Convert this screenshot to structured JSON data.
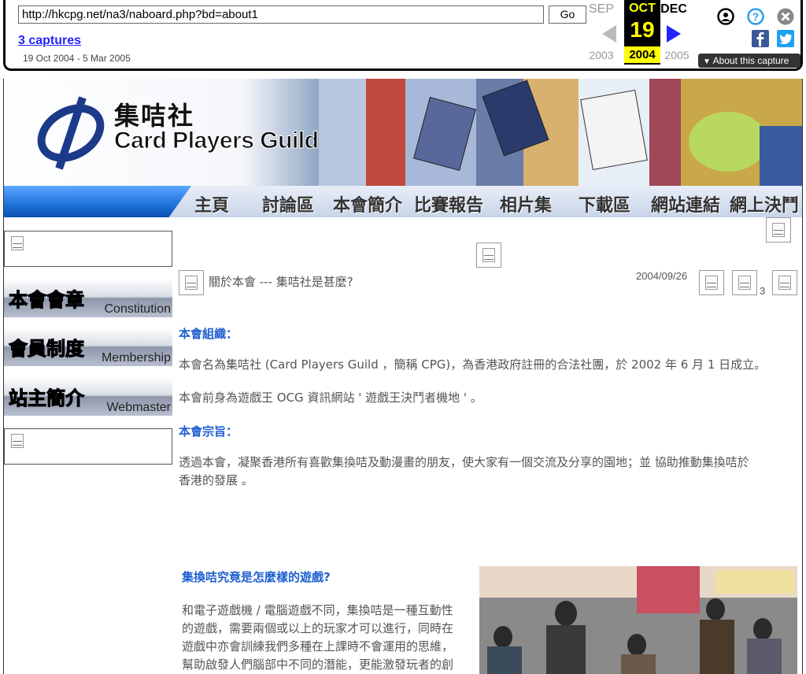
{
  "wayback": {
    "url": "http://hkcpg.net/na3/naboard.php?bd=about1",
    "go_label": "Go",
    "captures_label": "3 captures",
    "date_range": "19 Oct 2004 - 5 Mar 2005",
    "prev_month": "SEP",
    "cur_month": "OCT",
    "next_month": "DEC",
    "cur_day": "19",
    "prev_year": "2003",
    "cur_year": "2004",
    "next_year": "2005",
    "about_label": "About this capture",
    "icons": [
      "user-icon",
      "help-icon",
      "close-icon",
      "facebook-icon",
      "twitter-icon"
    ]
  },
  "banner": {
    "title_cn": "集咭社",
    "title_en": "Card Players Guild"
  },
  "nav": {
    "items": [
      "主頁",
      "討論區",
      "本會簡介",
      "比賽報告",
      "相片集",
      "下載區",
      "網站連結",
      "網上決鬥"
    ]
  },
  "sidebar": {
    "buttons": [
      {
        "cn": "本會會章",
        "en": "Constitution",
        "color": "#1a8fd8"
      },
      {
        "cn": "會員制度",
        "en": "Membership",
        "color": "#e08a10"
      },
      {
        "cn": "站主簡介",
        "en": "Webmaster",
        "color": "#2fb02f"
      }
    ]
  },
  "post": {
    "title": "關於本會 --- 集咭社是甚麼?",
    "date": "2004/09/26",
    "count": "3"
  },
  "content": {
    "org_head": "本會組織：",
    "org_p1": "本會名為集咭社 (Card Players Guild ，簡稱 CPG)，為香港政府註冊的合法社團，於 2002 年 6 月 1 日成立。",
    "org_p2": "本會前身為遊戲王 OCG 資訊網站 ' 遊戲王決鬥者機地 ' 。",
    "aim_head": "本會宗旨：",
    "aim_p1": "透過本會，凝聚香港所有喜歡集換咭及動漫畫的朋友，使大家有一個交流及分享的園地；並 協助推動集換咭於",
    "aim_p2": "香港的發展 。",
    "game_head": "集換咭究竟是怎麼樣的遊戲?",
    "game_lines": [
      "和電子遊戲機 / 電腦遊戲不同，集換咭是一種互動性",
      "的遊戲，需要兩個或以上的玩家才可以進行，同時在",
      "遊戲中亦會訓練我們多種在上課時不會運用的思維，",
      "幫助啟發人們腦部中不同的潛能，更能激發玩者的創"
    ]
  }
}
